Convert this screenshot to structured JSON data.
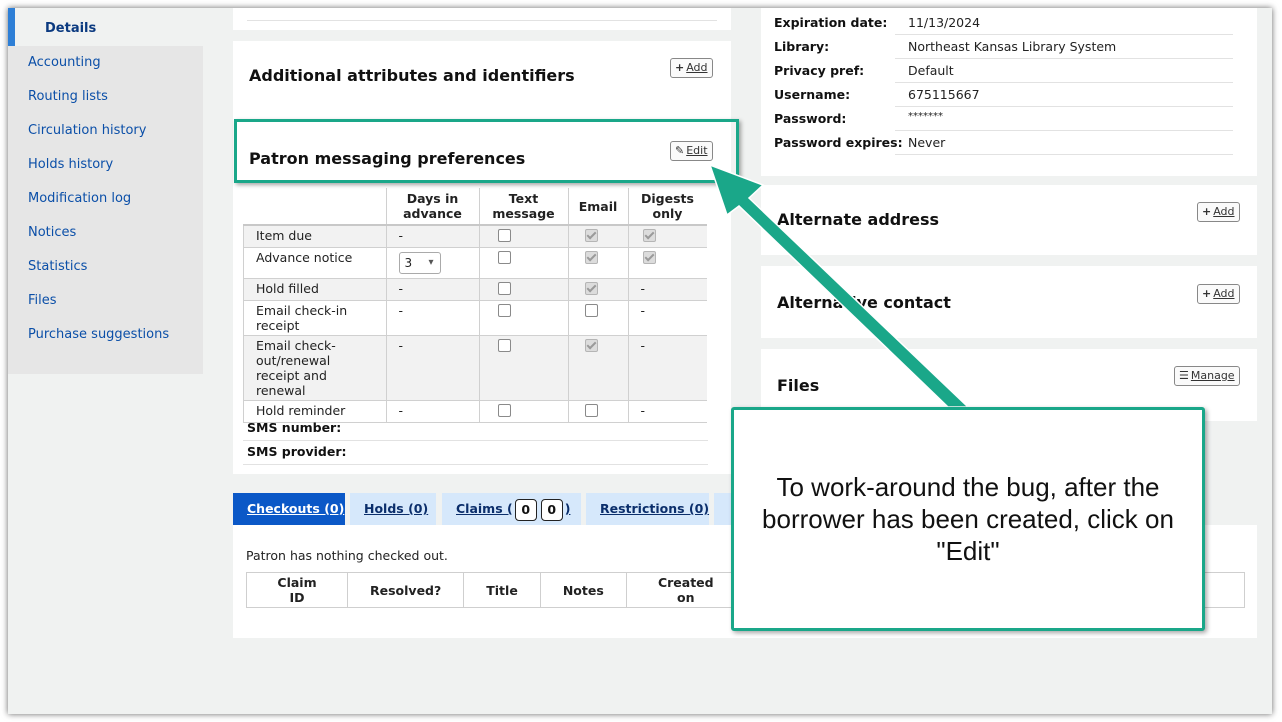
{
  "sidebar": {
    "items": [
      {
        "label": "Details",
        "active": true
      },
      {
        "label": "Accounting"
      },
      {
        "label": "Routing lists"
      },
      {
        "label": "Circulation history"
      },
      {
        "label": "Holds history"
      },
      {
        "label": "Modification log"
      },
      {
        "label": "Notices"
      },
      {
        "label": "Statistics"
      },
      {
        "label": "Files"
      },
      {
        "label": "Purchase suggestions"
      }
    ]
  },
  "attributes": {
    "title": "Additional attributes and identifiers",
    "add_label": "Add"
  },
  "messaging": {
    "title": "Patron messaging preferences",
    "edit_label": "Edit",
    "headers": [
      "",
      "Days in advance",
      "Text message",
      "Email",
      "Digests only"
    ],
    "rows": [
      {
        "label": "Item due",
        "days": "-",
        "sms": false,
        "email": true,
        "digest": true
      },
      {
        "label": "Advance notice",
        "days": "3",
        "sms": false,
        "email": true,
        "digest": true
      },
      {
        "label": "Hold filled",
        "days": "-",
        "sms": false,
        "email": true,
        "digest": "-"
      },
      {
        "label": "Email check-in receipt",
        "days": "-",
        "sms": false,
        "email": false,
        "digest": "-"
      },
      {
        "label": "Email check-out/renewal receipt and renewal",
        "days": "-",
        "sms": false,
        "email": true,
        "digest": "-"
      },
      {
        "label": "Hold reminder",
        "days": "-",
        "sms": false,
        "email": false,
        "digest": "-"
      }
    ],
    "sms_number_label": "SMS number:",
    "sms_provider_label": "SMS provider:"
  },
  "library_info": {
    "rows": [
      {
        "key": "Expiration date:",
        "value": "11/13/2024"
      },
      {
        "key": "Library:",
        "value": "Northeast Kansas Library System"
      },
      {
        "key": "Privacy pref:",
        "value": "Default"
      },
      {
        "key": "Username:",
        "value": "675115667"
      },
      {
        "key": "Password:",
        "value": "*******"
      },
      {
        "key": "Password expires:",
        "value": "Never"
      }
    ]
  },
  "alternate_address": {
    "title": "Alternate address",
    "add_label": "Add"
  },
  "alternative_contact": {
    "title": "Alternative contact",
    "add_label": "Add"
  },
  "files": {
    "title": "Files",
    "manage_label": "Manage"
  },
  "tabs": {
    "checkouts": "Checkouts (0)",
    "holds": "Holds (0)",
    "claims_prefix": "Claims (",
    "claims_a": "0",
    "claims_b": "0",
    "claims_suffix": ")",
    "restrictions": "Restrictions (0)"
  },
  "checkouts_panel": {
    "message": "Patron has nothing checked out.",
    "claim_headers": [
      "Claim ID",
      "Resolved?",
      "Title",
      "Notes",
      "Created on"
    ]
  },
  "callout": {
    "text": "To work-around the bug, after the borrower has been created, click on \"Edit\""
  },
  "colors": {
    "accent": "#1aa789",
    "link": "#0b4fa8",
    "tab_active": "#0b58c7"
  }
}
